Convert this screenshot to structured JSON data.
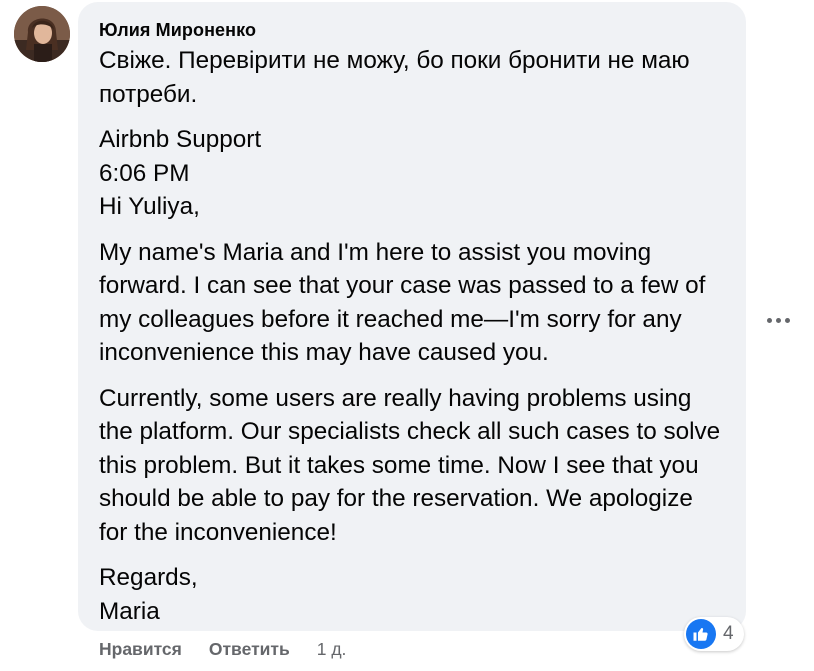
{
  "comment": {
    "author": "Юлия Мироненко",
    "paragraphs": [
      "Свіже. Перевірити не можу, бо поки бронити не маю\nпотреби.",
      "Airbnb Support\n6:06 PM\nHi Yuliya,",
      "My name's Maria and I'm here to assist you moving\nforward. I can see that your case was passed to a few of\nmy colleagues before it reached me—I'm sorry for any\ninconvenience this may have caused you.",
      "Currently, some users are really having problems using\nthe platform. Our specialists check all such cases to solve\nthis problem. But it takes some time. Now I see that you\nshould be able to pay for the reservation. We apologize\nfor the inconvenience!",
      "Regards,\nMaria"
    ]
  },
  "actions": {
    "like_label": "Нравится",
    "reply_label": "Ответить",
    "timestamp": "1 д."
  },
  "reactions": {
    "icon": "thumbs-up-icon",
    "count": "4",
    "color": "#1877f2"
  },
  "more_menu": {
    "icon": "more-horizontal-icon"
  }
}
